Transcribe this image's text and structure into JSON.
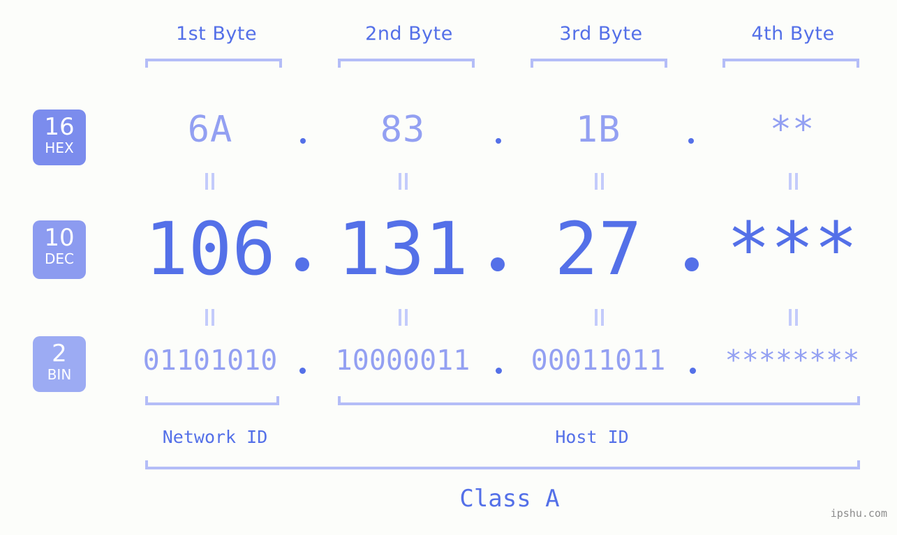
{
  "background_color": "#fcfdfa",
  "accent_color": "#5470e8",
  "accent_light_color": "#93a0f2",
  "bracket_color": "#b4bdf7",
  "byte_headers": [
    {
      "label": "1st Byte"
    },
    {
      "label": "2nd Byte"
    },
    {
      "label": "3rd Byte"
    },
    {
      "label": "4th Byte"
    }
  ],
  "rows": {
    "hex": {
      "badge_number": "16",
      "badge_name": "HEX",
      "badge_color": "#7b8ced",
      "values": [
        "6A",
        "83",
        "1B",
        "**"
      ],
      "separator": "."
    },
    "dec": {
      "badge_number": "10",
      "badge_name": "DEC",
      "badge_color": "#8c9bf0",
      "values": [
        "106",
        "131",
        "27",
        "***"
      ],
      "separator": "."
    },
    "bin": {
      "badge_number": "2",
      "badge_name": "BIN",
      "badge_color": "#9cabf3",
      "values": [
        "01101010",
        "10000011",
        "00011011",
        "********"
      ],
      "separator": "."
    }
  },
  "equality_marker": "||",
  "segments": {
    "network_id": "Network ID",
    "host_id": "Host ID",
    "class": "Class A"
  },
  "watermark": "ipshu.com"
}
